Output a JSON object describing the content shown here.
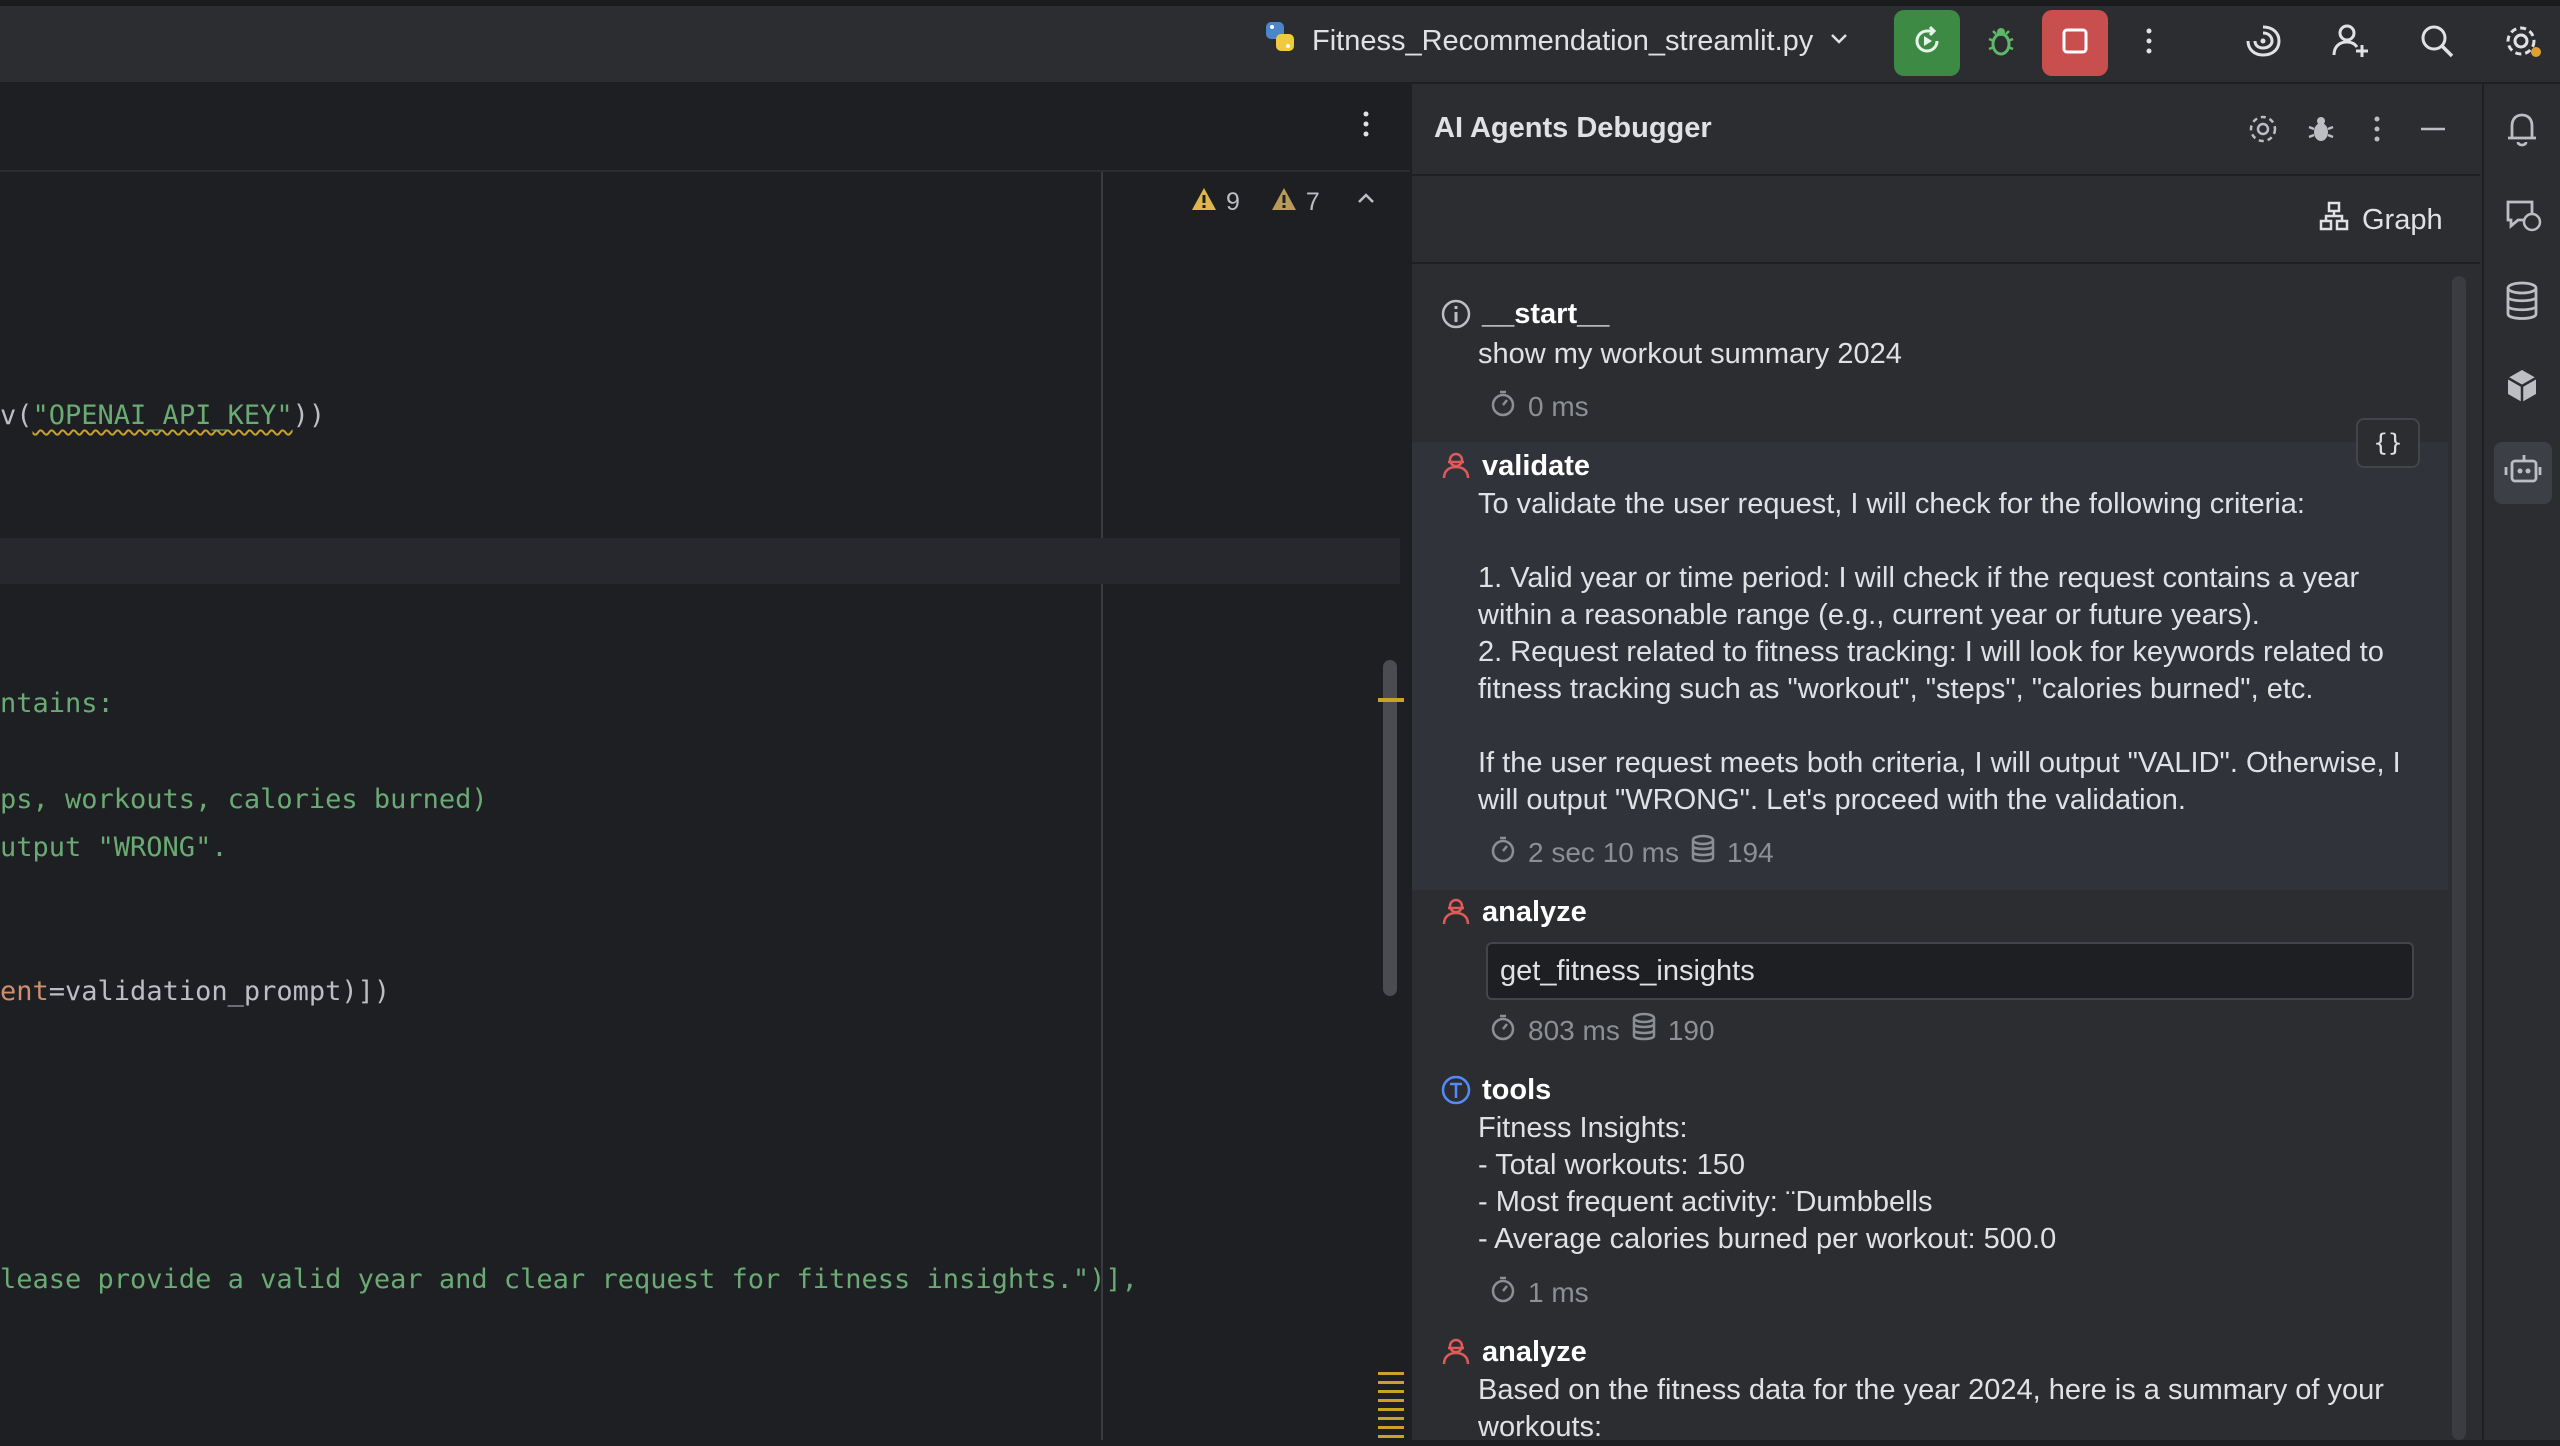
{
  "topbar": {
    "run_config_name": "Fitness_Recommendation_streamlit.py",
    "icons": [
      "python-icon",
      "chevron-down-icon",
      "rerun-icon",
      "debug-icon",
      "stop-icon",
      "more-icon",
      "ai-assistant-icon",
      "add-user-icon",
      "search-icon",
      "settings-icon"
    ],
    "colors": {
      "rerun_bg": "#3d8a45",
      "stop_bg": "#c94f4f",
      "debug": "#5fb865"
    }
  },
  "editor": {
    "warnings_count": "9",
    "weak_warnings_count": "7",
    "lines": [
      {
        "pre": "v(",
        "str": "\"OPENAI_API_KEY\"",
        "post": "))"
      },
      {
        "text": "ntains:"
      },
      {
        "text": "ps, workouts, calories burned)"
      },
      {
        "text": "utput \"WRONG\"."
      },
      {
        "kw": "ent",
        "post": "=validation_prompt)])"
      },
      {
        "text": "lease provide a valid year and clear request for fitness insights.\")],"
      }
    ]
  },
  "debugger": {
    "title": "AI Agents Debugger",
    "graph_label": "Graph",
    "nodes": [
      {
        "name": "__start__",
        "text": "show my workout summary 2024",
        "time": "0 ms"
      },
      {
        "name": "validate",
        "text": "To validate the user request, I will check for the following criteria:\n\n1. Valid year or time period: I will check if the request contains a year within a reasonable range (e.g., current year or future years).\n2. Request related to fitness tracking: I will look for keywords related to fitness tracking such as \"workout\", \"steps\", \"calories burned\", etc.\n\nIf the user request meets both criteria, I will output \"VALID\". Otherwise, I will output \"WRONG\". Let's proceed with the validation.",
        "time": "2 sec 10 ms",
        "tokens": "194"
      },
      {
        "name": "analyze",
        "tool_call": "get_fitness_insights",
        "time": "803 ms",
        "tokens": "190"
      },
      {
        "name": "tools",
        "text": "Fitness Insights:\n- Total workouts: 150\n- Most frequent activity: ¨Dumbbells\n- Average calories burned per workout: 500.0",
        "time": "1 ms"
      },
      {
        "name": "analyze",
        "text": "Based on the fitness data for the year 2024, here is a summary of your workouts:"
      }
    ],
    "json_button": "{}"
  }
}
